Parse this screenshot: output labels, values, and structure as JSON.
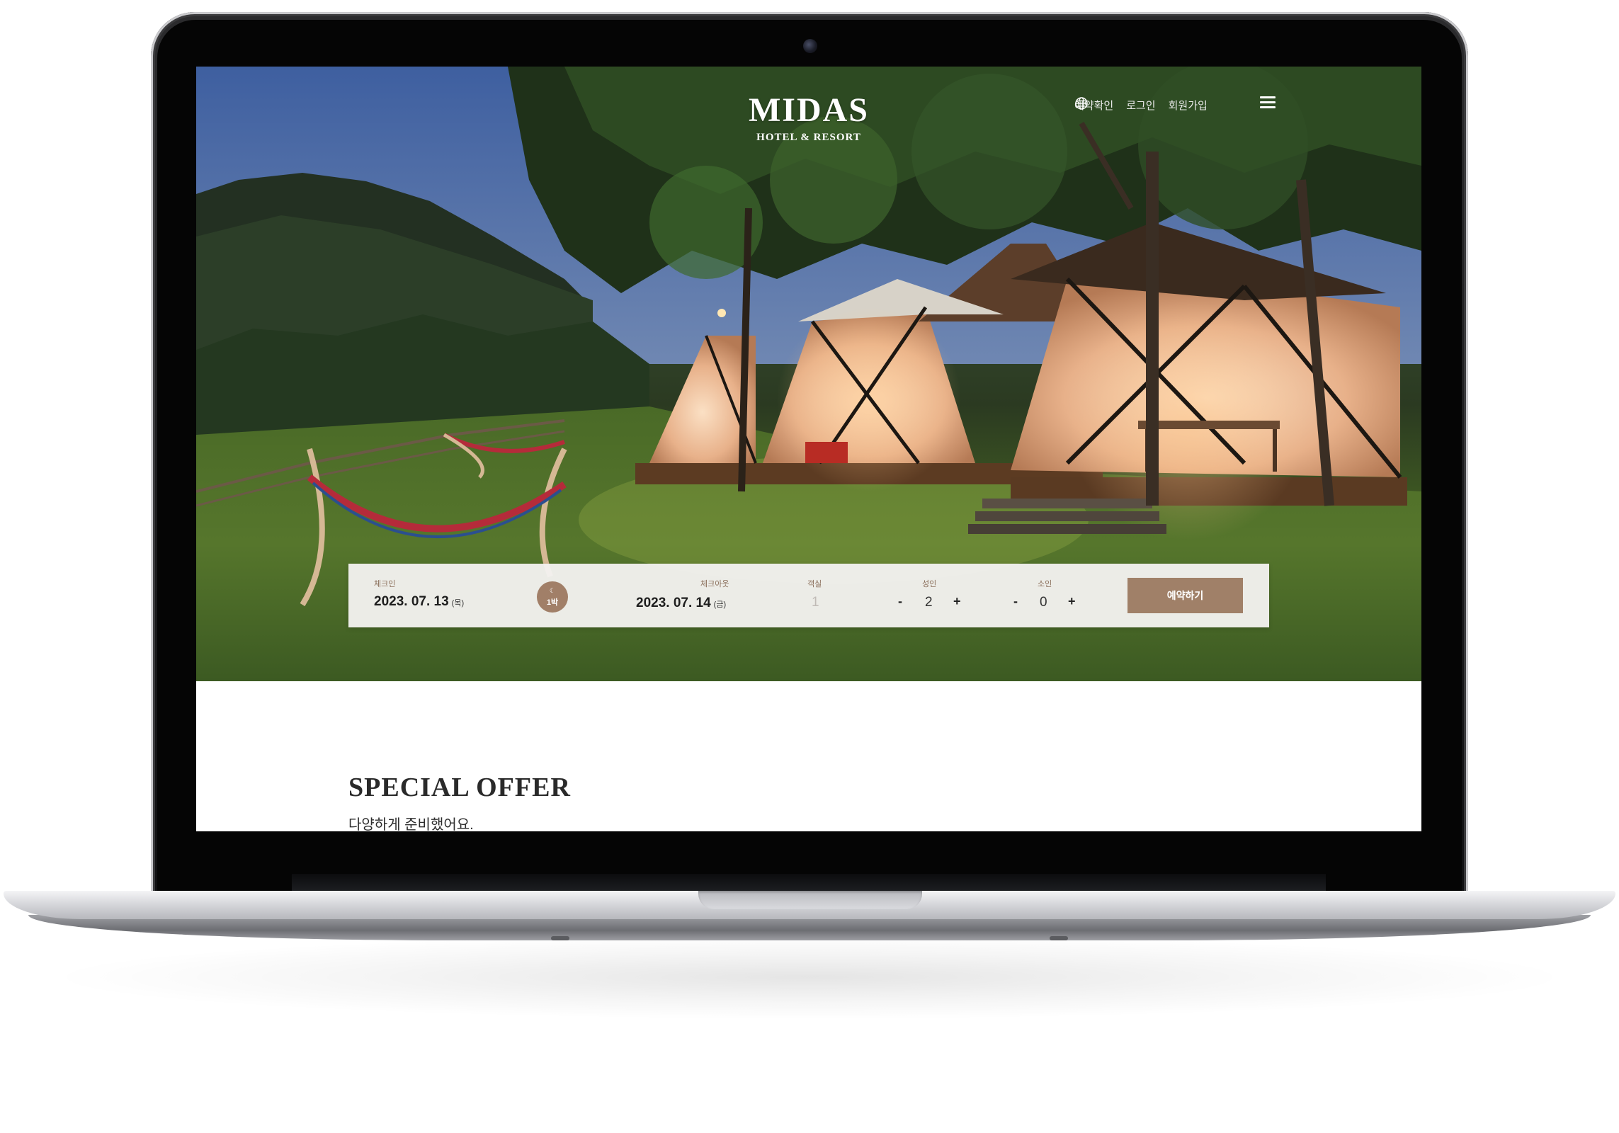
{
  "header": {
    "logo_main": "MIDAS",
    "logo_sub": "HOTEL & RESORT",
    "nav": [
      "예약확인",
      "로그인",
      "회원가입"
    ]
  },
  "booking": {
    "checkin_label": "체크인",
    "checkin_date": "2023. 07. 13",
    "checkin_day": "(목)",
    "nights": "1박",
    "checkout_label": "체크아웃",
    "checkout_date": "2023. 07. 14",
    "checkout_day": "(금)",
    "rooms_label": "객실",
    "rooms_value": "1",
    "adults_label": "성인",
    "adults_value": "2",
    "children_label": "소인",
    "children_value": "0",
    "minus": "-",
    "plus": "+",
    "reserve_label": "예약하기"
  },
  "section": {
    "title": "SPECIAL OFFER",
    "subtitle": "다양하게 준비했어요."
  },
  "colors": {
    "accent": "#a08068",
    "label": "#8a6e5a",
    "bar_bg": "#f2f1ef"
  },
  "icons": [
    "globe-icon",
    "menu-icon",
    "moon-icon"
  ]
}
